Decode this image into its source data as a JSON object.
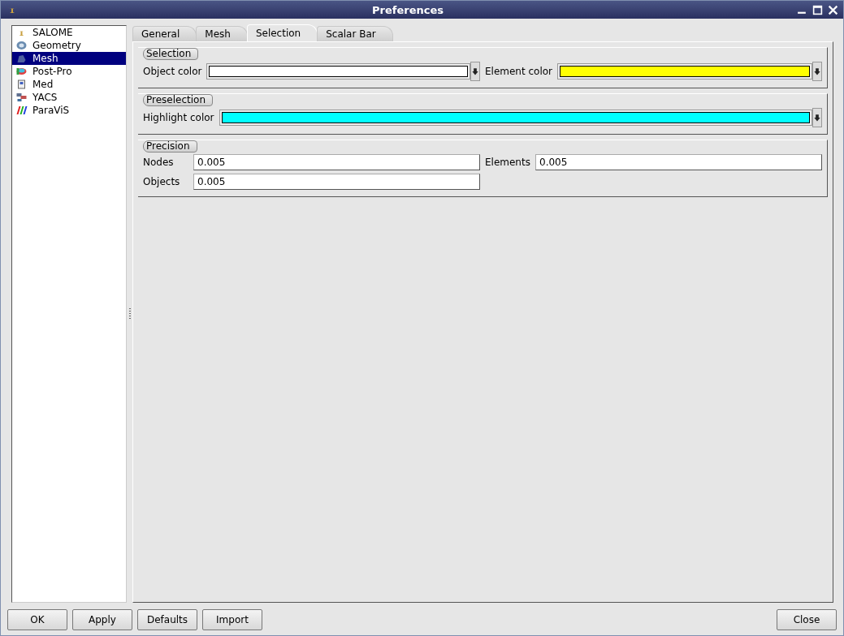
{
  "window": {
    "title": "Preferences"
  },
  "sidebar": {
    "items": [
      {
        "label": "SALOME",
        "selected": false
      },
      {
        "label": "Geometry",
        "selected": false
      },
      {
        "label": "Mesh",
        "selected": true
      },
      {
        "label": "Post-Pro",
        "selected": false
      },
      {
        "label": "Med",
        "selected": false
      },
      {
        "label": "YACS",
        "selected": false
      },
      {
        "label": "ParaViS",
        "selected": false
      }
    ]
  },
  "tabs": [
    {
      "label": "General",
      "selected": false
    },
    {
      "label": "Mesh",
      "selected": false
    },
    {
      "label": "Selection",
      "selected": true
    },
    {
      "label": "Scalar Bar",
      "selected": false
    }
  ],
  "groups": [
    {
      "title": "Selection",
      "rows": [
        [
          {
            "kind": "color",
            "label": "Object color",
            "color": "#ffffff"
          },
          {
            "kind": "color",
            "label": "Element color",
            "color": "#ffff00"
          }
        ]
      ]
    },
    {
      "title": "Preselection",
      "rows": [
        [
          {
            "kind": "color",
            "label": "Highlight color",
            "color": "#00ffff"
          }
        ]
      ]
    },
    {
      "title": "Precision",
      "rows": [
        [
          {
            "kind": "number",
            "label": "Nodes",
            "value": "0.005"
          },
          {
            "kind": "number",
            "label": "Elements",
            "value": "0.005"
          }
        ],
        [
          {
            "kind": "number",
            "label": "Objects",
            "value": "0.005"
          }
        ]
      ]
    }
  ],
  "buttons": {
    "left": [
      "OK",
      "Apply",
      "Defaults",
      "Import"
    ],
    "right": [
      "Close"
    ]
  }
}
